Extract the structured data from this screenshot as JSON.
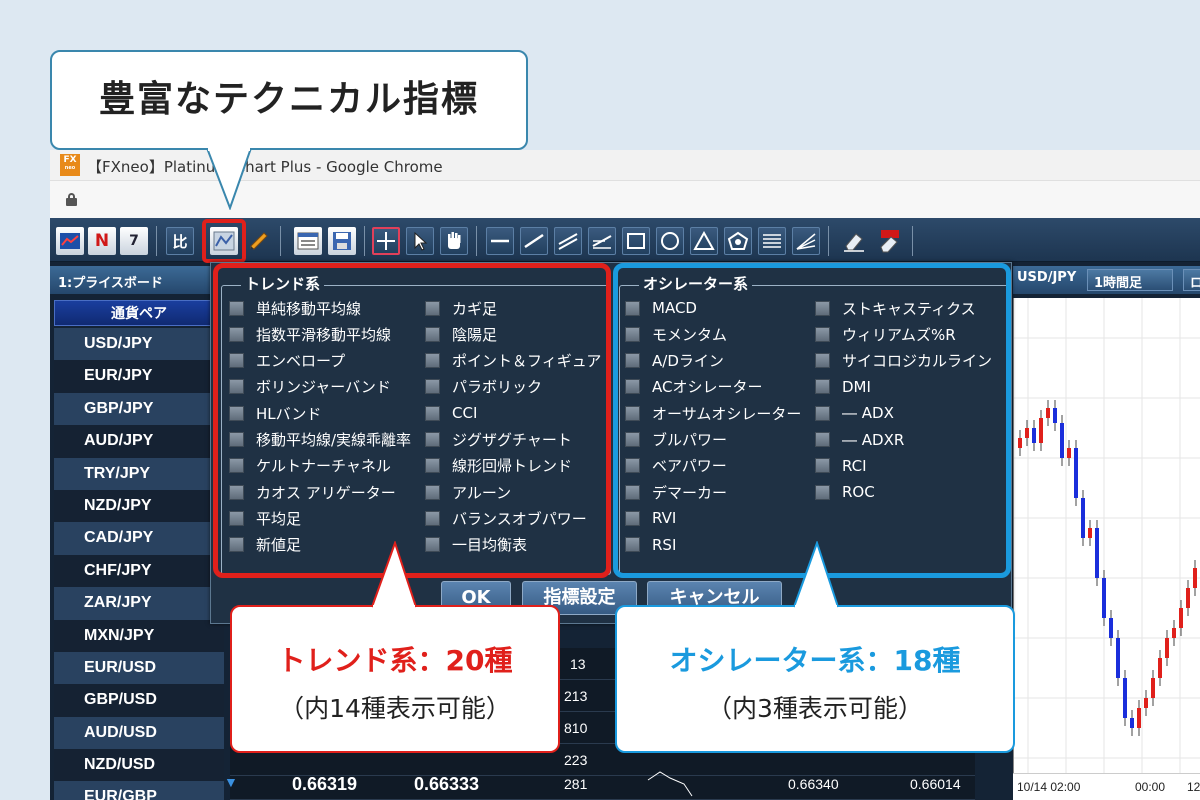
{
  "callout": {
    "title": "豊富なテクニカル指標",
    "trend_line1": "トレンド系：20種",
    "trend_line2": "（内14種表示可能）",
    "osc_line1": "オシレーター系：18種",
    "osc_line2": "（内3種表示可能）"
  },
  "window": {
    "logo_top": "FX",
    "logo_bottom": "neo",
    "title": "【FXneo】Platinum Chart Plus - Google Chrome"
  },
  "toolbar": {
    "compare_label": "比",
    "calendar_label": "7",
    "news_label": "N"
  },
  "price_board": {
    "header": "1:プライスボード",
    "col_header": "通貨ペア",
    "pairs": [
      "USD/JPY",
      "EUR/JPY",
      "GBP/JPY",
      "AUD/JPY",
      "TRY/JPY",
      "NZD/JPY",
      "CAD/JPY",
      "CHF/JPY",
      "ZAR/JPY",
      "MXN/JPY",
      "EUR/USD",
      "GBP/USD",
      "AUD/USD",
      "NZD/USD",
      "EUR/GBP"
    ]
  },
  "table": {
    "rows": [
      {
        "count": "13"
      },
      {
        "count": "213"
      },
      {
        "count": "810"
      },
      {
        "count": "223"
      },
      {
        "bid": "0.66319",
        "ask": "0.66333",
        "count": "281",
        "high": "0.66340",
        "low": "0.66014"
      }
    ]
  },
  "chart": {
    "pair": "USD/JPY",
    "timeframe": "1時間足",
    "tf_extra": "ロ",
    "axis": [
      "10/14 02:00",
      "00:00",
      "12"
    ]
  },
  "dialog": {
    "trend_title": "トレンド系",
    "trend_col1": [
      "単純移動平均線",
      "指数平滑移動平均線",
      "エンベロープ",
      "ボリンジャーバンド",
      "HLバンド",
      "移動平均線/実線乖離率",
      "ケルトナーチャネル",
      "カオス アリゲーター",
      "平均足",
      "新値足"
    ],
    "trend_col2": [
      "カギ足",
      "陰陽足",
      "ポイント＆フィギュア",
      "パラボリック",
      "CCI",
      "ジグザグチャート",
      "線形回帰トレンド",
      "アルーン",
      "バランスオブパワー",
      "一目均衡表"
    ],
    "osc_title": "オシレーター系",
    "osc_col1": [
      "MACD",
      "モメンタム",
      "A/Dライン",
      "ACオシレーター",
      "オーサムオシレーター",
      "ブルパワー",
      "ベアパワー",
      "デマーカー",
      "RVI",
      "RSI"
    ],
    "osc_col2": [
      "ストキャスティクス",
      "ウィリアムズ%R",
      "サイコロジカルライン",
      "DMI",
      "― ADX",
      "― ADXR",
      "RCI",
      "ROC"
    ],
    "ok": "OK",
    "settings": "指標設定",
    "cancel": "キャンセル"
  },
  "colors": {
    "trend_accent": "#e0201b",
    "osc_accent": "#1a9ade",
    "bullish_candle": "#e0201b",
    "bearish_candle": "#1a2edb"
  }
}
